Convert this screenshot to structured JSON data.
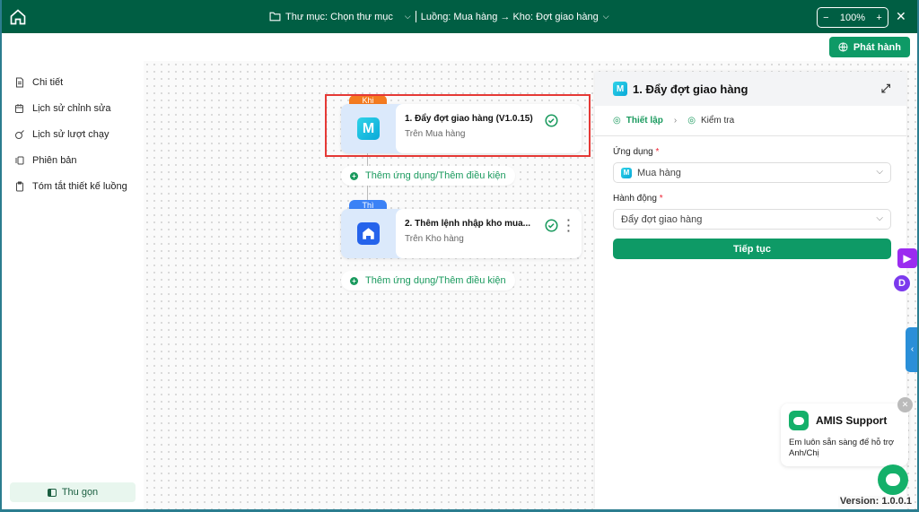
{
  "header": {
    "folder_label": "Thư mục: Chọn thư mục",
    "flow_label": "Luồng: Mua hàng → Kho: Đợt giao hàng",
    "zoom": "100%",
    "zoom_minus": "−",
    "zoom_plus": "+",
    "close": "✕"
  },
  "toolbar": {
    "publish_label": "Phát hành"
  },
  "sidebar": {
    "items": [
      {
        "label": "Chi tiết",
        "icon": "document-icon"
      },
      {
        "label": "Lịch sử chỉnh sửa",
        "icon": "calendar-icon"
      },
      {
        "label": "Lịch sử lượt chạy",
        "icon": "run-icon"
      },
      {
        "label": "Phiên bản",
        "icon": "version-icon"
      },
      {
        "label": "Tóm tắt thiết kế luồng",
        "icon": "clipboard-icon"
      }
    ],
    "collapse_label": "Thu gọn"
  },
  "flow": {
    "nodes": [
      {
        "tag": "Khi",
        "title": "1.  Đẩy đợt giao hàng (V1.0.15)",
        "subtitle": "Trên Mua hàng",
        "tag_color": "#f47b20",
        "logo": "M"
      },
      {
        "tag": "Thì",
        "title": "2.  Thêm lệnh nhập kho mua...",
        "subtitle": "Trên Kho hàng",
        "tag_color": "#3b82f6"
      }
    ],
    "add_label": "Thêm ứng dụng/Thêm điều kiện"
  },
  "panel": {
    "logo": "M",
    "title": "1. Đẩy đợt giao hàng",
    "steps": [
      "Thiết lập",
      "Kiểm tra"
    ],
    "app_label": "Ứng dụng",
    "app_value": "Mua hàng",
    "action_label": "Hành động",
    "action_value": "Đẩy đợt giao hàng",
    "required": "*",
    "continue_label": "Tiếp tục"
  },
  "side_widgets": {
    "d_label": "D"
  },
  "support": {
    "title": "AMIS Support",
    "message": "Em luôn sẵn sàng để hỗ trợ Anh/Chị",
    "close": "✕"
  },
  "version": "Version: 1.0.0.1",
  "colors": {
    "header": "#005e43",
    "accent": "#0e9a66",
    "highlight": "#e53935"
  }
}
